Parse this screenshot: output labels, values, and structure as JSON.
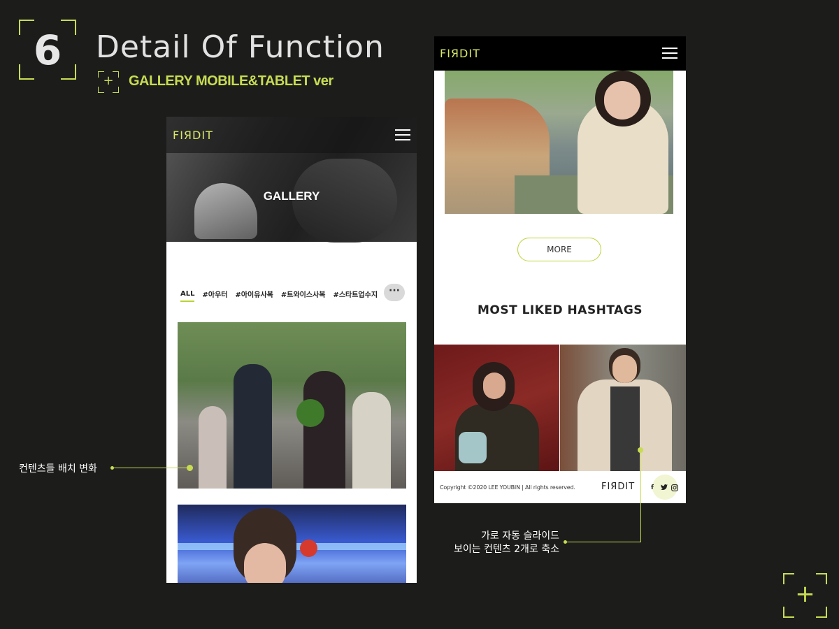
{
  "slide": {
    "number": "6",
    "title": "Detail Of Function",
    "subtitle": "GALLERY MOBILE&TABLET ver",
    "accent_color": "#c8dc52"
  },
  "phone_gallery": {
    "logo": "FIЯDIT",
    "menu_icon": "hamburger-icon",
    "hero_title": "GALLERY",
    "tabs": [
      "ALL",
      "#아우터",
      "#아이유사복",
      "#트와이스사복",
      "#스타트업수지"
    ],
    "active_tab": "ALL",
    "more_tabs_icon": "···"
  },
  "phone_main": {
    "logo": "FIЯDIT",
    "menu_icon": "hamburger-icon",
    "more_button": "MORE",
    "section_title": "MOST LIKED HASHTAGS",
    "footer": {
      "copyright": "Copyright ©2020 LEE YOUBIN | All rights reserved.",
      "logo": "FIЯDIT",
      "sns": [
        "f",
        "t",
        "ig"
      ]
    }
  },
  "annotations": {
    "note1": "컨텐츠들 배치 변화",
    "note2_line1": "가로 자동 슬라이드",
    "note2_line2": "보이는 컨텐츠 2개로 축소"
  }
}
